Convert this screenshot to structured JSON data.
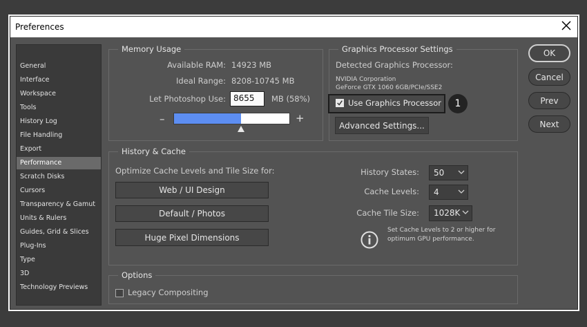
{
  "window": {
    "title": "Preferences"
  },
  "sidebar": {
    "items": [
      {
        "label": "General"
      },
      {
        "label": "Interface"
      },
      {
        "label": "Workspace"
      },
      {
        "label": "Tools"
      },
      {
        "label": "History Log"
      },
      {
        "label": "File Handling"
      },
      {
        "label": "Export"
      },
      {
        "label": "Performance",
        "active": true
      },
      {
        "label": "Scratch Disks"
      },
      {
        "label": "Cursors"
      },
      {
        "label": "Transparency & Gamut"
      },
      {
        "label": "Units & Rulers"
      },
      {
        "label": "Guides, Grid & Slices"
      },
      {
        "label": "Plug-Ins"
      },
      {
        "label": "Type"
      },
      {
        "label": "3D"
      },
      {
        "label": "Technology Previews"
      }
    ]
  },
  "memory": {
    "title": "Memory Usage",
    "available_label": "Available RAM:",
    "available_value": "14923 MB",
    "ideal_label": "Ideal Range:",
    "ideal_value": "8208-10745 MB",
    "let_label": "Let Photoshop Use:",
    "let_value": "8655",
    "let_unit": "MB (58%)",
    "slider_fraction": 0.58,
    "minus": "–",
    "plus": "+"
  },
  "gpu": {
    "title": "Graphics Processor Settings",
    "detected_label": "Detected Graphics Processor:",
    "vendor": "NVIDIA Corporation",
    "model": "GeForce GTX 1060 6GB/PCIe/SSE2",
    "use_label": "Use Graphics Processor",
    "use_checked": true,
    "badge": "1",
    "advanced_label": "Advanced Settings..."
  },
  "history": {
    "title": "History & Cache",
    "optimize_label": "Optimize Cache Levels and Tile Size for:",
    "btn_web": "Web / UI Design",
    "btn_default": "Default / Photos",
    "btn_huge": "Huge Pixel Dimensions",
    "states_label": "History States:",
    "states_value": "50",
    "levels_label": "Cache Levels:",
    "levels_value": "4",
    "tile_label": "Cache Tile Size:",
    "tile_value": "1028K",
    "info_line1": "Set Cache Levels to 2 or higher for",
    "info_line2": "optimum GPU performance."
  },
  "options": {
    "title": "Options",
    "legacy_label": "Legacy Compositing",
    "legacy_checked": false
  },
  "buttons": {
    "ok": "OK",
    "cancel": "Cancel",
    "prev": "Prev",
    "next": "Next"
  },
  "colors": {
    "accent": "#5d8ef2",
    "panel": "#535353",
    "background": "#3c3c3c"
  }
}
